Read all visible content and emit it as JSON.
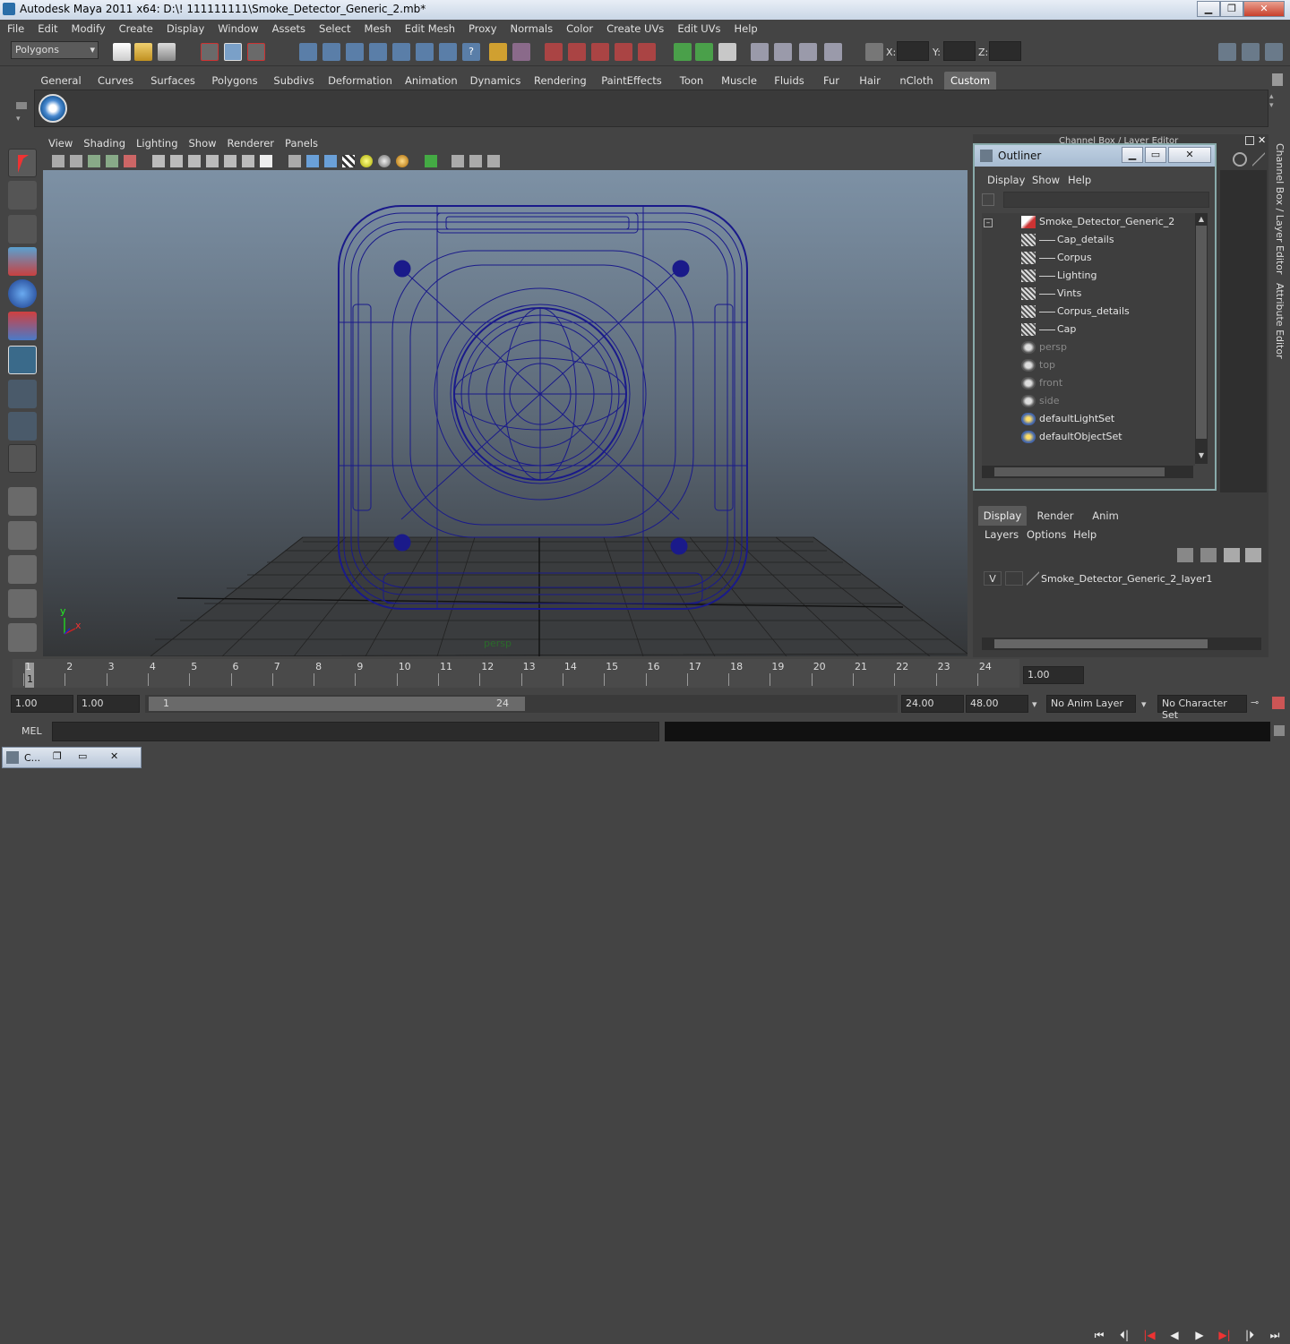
{
  "window": {
    "title": "Autodesk Maya 2011 x64: D:\\! 111111111\\Smoke_Detector_Generic_2.mb*"
  },
  "menubar": [
    "File",
    "Edit",
    "Modify",
    "Create",
    "Display",
    "Window",
    "Assets",
    "Select",
    "Mesh",
    "Edit Mesh",
    "Proxy",
    "Normals",
    "Color",
    "Create UVs",
    "Edit UVs",
    "Help"
  ],
  "status": {
    "mode": "Polygons",
    "x_label": "X:",
    "y_label": "Y:",
    "z_label": "Z:"
  },
  "shelf_tabs": [
    "General",
    "Curves",
    "Surfaces",
    "Polygons",
    "Subdivs",
    "Deformation",
    "Animation",
    "Dynamics",
    "Rendering",
    "PaintEffects",
    "Toon",
    "Muscle",
    "Fluids",
    "Fur",
    "Hair",
    "nCloth",
    "Custom"
  ],
  "shelf_active": "Custom",
  "viewport": {
    "menu": [
      "View",
      "Shading",
      "Lighting",
      "Show",
      "Renderer",
      "Panels"
    ],
    "camera_label": "persp",
    "axis_y": "y",
    "axis_x": "x"
  },
  "channel_box_title": "Channel Box / Layer Editor",
  "side_tabs": [
    "Channel Box / Layer Editor",
    "Attribute Editor"
  ],
  "outliner": {
    "title": "Outliner",
    "menu": [
      "Display",
      "Show",
      "Help"
    ],
    "items": [
      {
        "label": "Smoke_Detector_Generic_2",
        "dim": false,
        "kind": "root"
      },
      {
        "label": "Cap_details",
        "dim": false,
        "kind": "child"
      },
      {
        "label": "Corpus",
        "dim": false,
        "kind": "child"
      },
      {
        "label": "Lighting",
        "dim": false,
        "kind": "child"
      },
      {
        "label": "Vints",
        "dim": false,
        "kind": "child"
      },
      {
        "label": "Corpus_details",
        "dim": false,
        "kind": "child"
      },
      {
        "label": "Cap",
        "dim": false,
        "kind": "child"
      },
      {
        "label": "persp",
        "dim": true,
        "kind": "camera"
      },
      {
        "label": "top",
        "dim": true,
        "kind": "camera"
      },
      {
        "label": "front",
        "dim": true,
        "kind": "camera"
      },
      {
        "label": "side",
        "dim": true,
        "kind": "camera"
      },
      {
        "label": "defaultLightSet",
        "dim": false,
        "kind": "set"
      },
      {
        "label": "defaultObjectSet",
        "dim": false,
        "kind": "set"
      }
    ]
  },
  "layer_editor": {
    "tabs": [
      "Display",
      "Render",
      "Anim"
    ],
    "active_tab": "Display",
    "menu": [
      "Layers",
      "Options",
      "Help"
    ],
    "layers": [
      {
        "visible": "V",
        "name": "Smoke_Detector_Generic_2_layer1"
      }
    ]
  },
  "timeline": {
    "ticks": [
      "1",
      "2",
      "3",
      "4",
      "5",
      "6",
      "7",
      "8",
      "9",
      "10",
      "11",
      "12",
      "13",
      "14",
      "15",
      "16",
      "17",
      "18",
      "19",
      "20",
      "21",
      "22",
      "23",
      "24"
    ],
    "current_frame_marker": "1",
    "current_time": "1.00"
  },
  "range": {
    "start": "1.00",
    "playback_start": "1.00",
    "slider_start": "1",
    "slider_end": "24",
    "playback_end": "24.00",
    "end": "48.00",
    "anim_layer": "No Anim Layer",
    "character_set": "No Character Set"
  },
  "cmdline": {
    "label": "MEL"
  },
  "taskbar": {
    "label": "C..."
  }
}
